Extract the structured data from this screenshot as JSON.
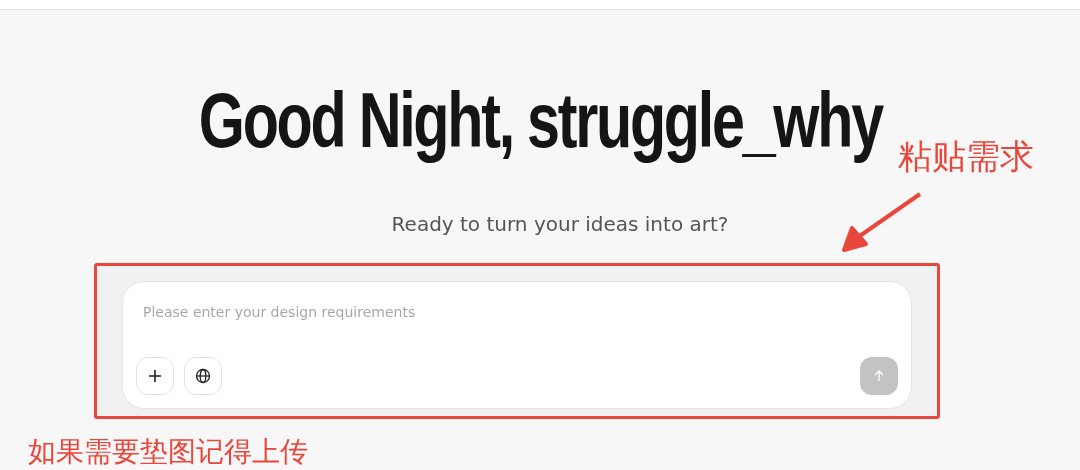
{
  "greeting": "Good Night, struggle_why",
  "subtitle": "Ready to turn your ideas into art?",
  "prompt_box": {
    "placeholder": "Please enter your design requirements",
    "buttons": [
      {
        "kind": "add"
      },
      {
        "kind": "web"
      }
    ],
    "send": {
      "disabled": true
    }
  },
  "annotations": [
    {
      "text": "粘贴需求"
    },
    {
      "text": "如果需要垫图记得上传"
    }
  ]
}
